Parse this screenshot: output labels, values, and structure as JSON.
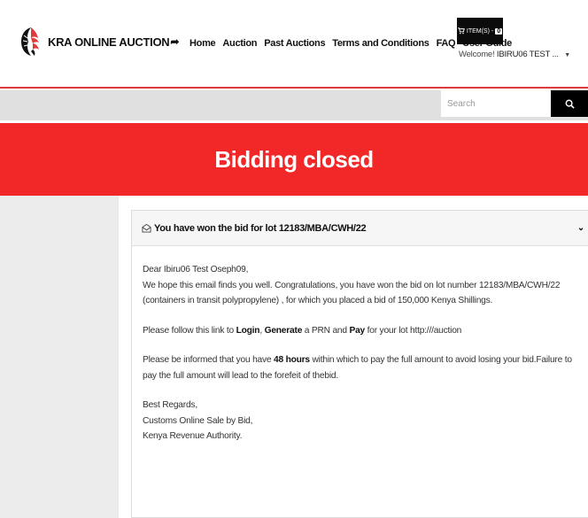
{
  "header": {
    "logo_text": "KRA ONLINE AUCTION",
    "nav": [
      "Home",
      "Auction",
      "Past Auctions",
      "Terms and Conditions",
      "FAQ",
      "User Guide"
    ],
    "cart": {
      "label": "ITEM(S) -",
      "count": "0",
      "icon": "cart-icon"
    },
    "welcome_prefix": "Welcome!",
    "welcome_user": "IBIRU06 TEST ..."
  },
  "search": {
    "placeholder": "Search",
    "icon": "search-icon"
  },
  "banner": {
    "text": "Bidding closed"
  },
  "message": {
    "subject": "You have won the bid for lot 12183/MBA/CWH/22",
    "greeting": "Dear Ibiru06 Test Oseph09,",
    "para1": "We hope this email finds you well. Congratulations, you have won the bid on lot number 12183/MBA/CWH/22 (containers in transit polypropylene) , for which you placed a bid of 150,000 Kenya Shillings.",
    "para2": {
      "prefix": "Please follow this link to ",
      "login": "Login",
      "sep": ", ",
      "generate": "Generate",
      "mid": " a PRN and ",
      "pay": "Pay",
      "suffix": " for your lot http:///auction"
    },
    "para3": {
      "prefix": "Please be informed that you have ",
      "hours": "48 hours",
      "suffix": " within which to pay the full amount to avoid losing your bid.Failure to pay the full amount will lead to the forefeit of thebid."
    },
    "signature": [
      "Best Regards,",
      "Customs Online Sale by Bid,",
      "Kenya Revenue Authority."
    ]
  },
  "colors": {
    "accent_red": "#f22727",
    "header_border": "#e03a3a",
    "dark": "#0b0b0b"
  }
}
